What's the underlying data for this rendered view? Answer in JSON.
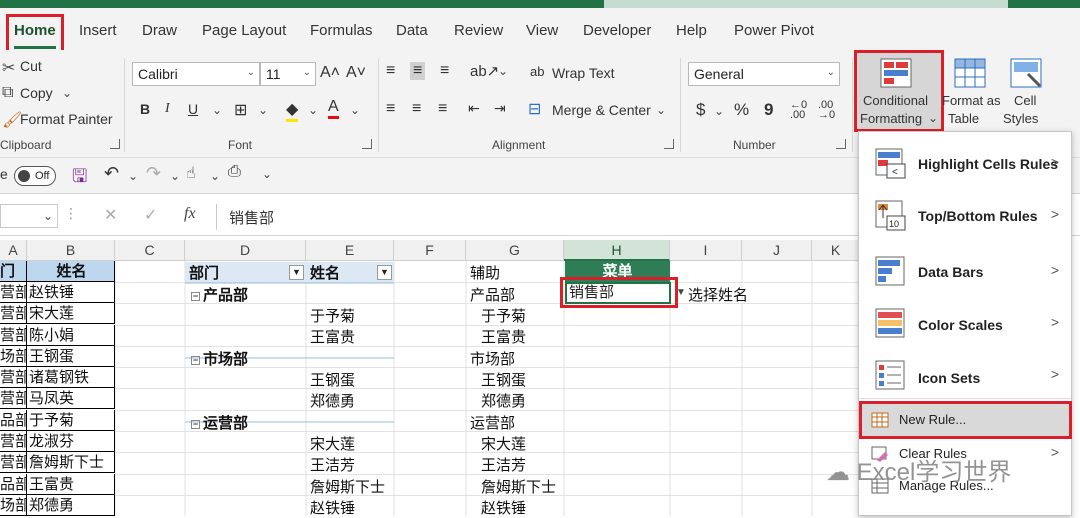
{
  "tabs": [
    "Home",
    "Insert",
    "Draw",
    "Page Layout",
    "Formulas",
    "Data",
    "Review",
    "View",
    "Developer",
    "Help",
    "Power Pivot"
  ],
  "clipboard": {
    "cut": "Cut",
    "copy": "Copy",
    "format_painter": "Format Painter",
    "group": "Clipboard"
  },
  "font": {
    "name": "Calibri",
    "size": "11",
    "group": "Font",
    "bold": "B",
    "italic": "I",
    "underline": "U"
  },
  "alignment": {
    "wrap": "Wrap Text",
    "merge": "Merge & Center",
    "group": "Alignment"
  },
  "number": {
    "format": "General",
    "group": "Number",
    "currency": "$",
    "percent": "%",
    "comma": "9"
  },
  "styles": {
    "cond": "Conditional",
    "cond2": "Formatting",
    "fmt_table": "Format as",
    "fmt_table2": "Table",
    "cell_styles": "Cell",
    "cell_styles2": "Styles"
  },
  "qat": {
    "autosave": "e",
    "toggle": "Off"
  },
  "formula": {
    "fx": "fx",
    "value": "销售部"
  },
  "columns": [
    "A",
    "B",
    "C",
    "D",
    "E",
    "F",
    "G",
    "H",
    "I",
    "J",
    "K"
  ],
  "colA": [
    "门",
    "营部",
    "营部",
    "营部",
    "场部",
    "营部",
    "营部",
    "品部",
    "营部",
    "营部",
    "品部",
    "场部"
  ],
  "colB": [
    "姓名",
    "赵铁锤",
    "宋大莲",
    "陈小娟",
    "王钢蛋",
    "诸葛钢铁",
    "马凤英",
    "于予菊",
    "龙淑芬",
    "詹姆斯下士",
    "王富贵",
    "郑德勇"
  ],
  "pivot": {
    "h1": "部门",
    "h2": "姓名",
    "g1": "产品部",
    "g2": "市场部",
    "g3": "运营部",
    "p1": "于予菊",
    "p2": "王富贵",
    "m1": "王钢蛋",
    "m2": "郑德勇",
    "o1": "宋大莲",
    "o2": "王洁芳",
    "o3": "詹姆斯下士",
    "o4": "赵铁锤"
  },
  "colG": [
    "辅助",
    "产品部",
    "于予菊",
    "王富贵",
    "市场部",
    "王钢蛋",
    "郑德勇",
    "运营部",
    "宋大莲",
    "王洁芳",
    "詹姆斯下士",
    "赵铁锤"
  ],
  "H1": "菜单",
  "H2": "销售部",
  "I2": "选择姓名",
  "menu": {
    "highlight": "Highlight Cells Rules",
    "topbottom": "Top/Bottom Rules",
    "databars": "Data Bars",
    "colorscales": "Color Scales",
    "iconsets": "Icon Sets",
    "newrule": "New Rule...",
    "clear": "Clear Rules",
    "manage": "Manage Rules..."
  },
  "watermark": "Excel学习世界",
  "colors": {
    "accent": "#217346",
    "red": "#d9202a",
    "header_blue": "#bdd7ee"
  }
}
